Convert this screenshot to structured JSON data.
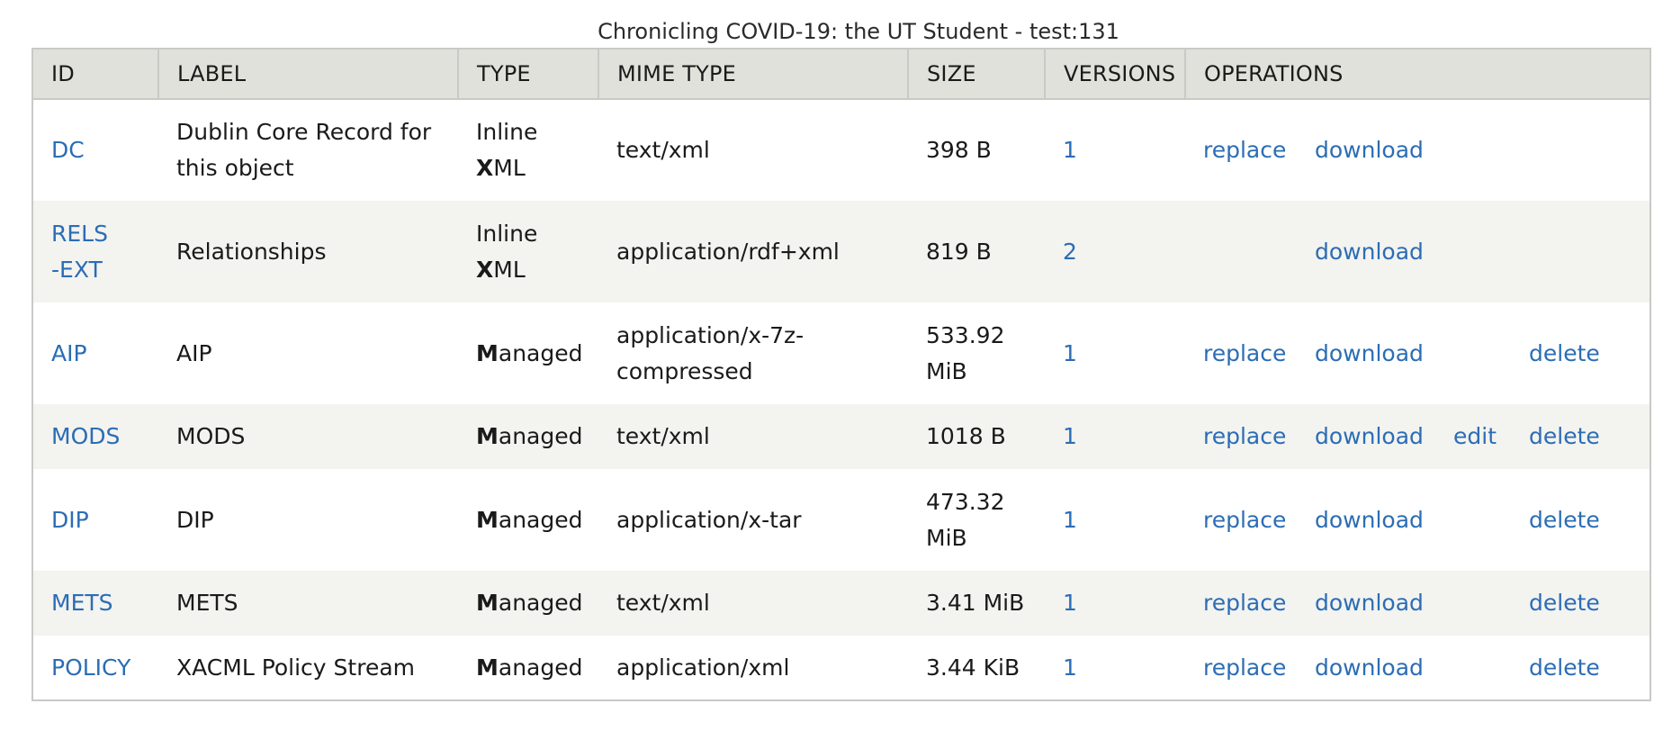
{
  "caption": "Chronicling COVID-19: the UT Student - test:131",
  "columns": [
    "ID",
    "LABEL",
    "TYPE",
    "MIME TYPE",
    "SIZE",
    "VERSIONS",
    "OPERATIONS"
  ],
  "rows": [
    {
      "id": "DC",
      "label": "Dublin Core Record for this object",
      "type_first": "Inline",
      "type_initial": "X",
      "type_rest": "ML",
      "mime": "text/xml",
      "size": "398 B",
      "versions": "1",
      "ops": {
        "replace": "replace",
        "download": "download",
        "edit": "",
        "delete": ""
      }
    },
    {
      "id": "RELS-EXT",
      "label": "Relationships",
      "type_first": "Inline",
      "type_initial": "X",
      "type_rest": "ML",
      "mime": "application/rdf+xml",
      "size": "819 B",
      "versions": "2",
      "ops": {
        "replace": "",
        "download": "download",
        "edit": "",
        "delete": ""
      }
    },
    {
      "id": "AIP",
      "label": "AIP",
      "type_first": "",
      "type_initial": "M",
      "type_rest": "anaged",
      "mime": "application/x-7z-compressed",
      "size": "533.92 MiB",
      "versions": "1",
      "ops": {
        "replace": "replace",
        "download": "download",
        "edit": "",
        "delete": "delete"
      }
    },
    {
      "id": "MODS",
      "label": "MODS",
      "type_first": "",
      "type_initial": "M",
      "type_rest": "anaged",
      "mime": "text/xml",
      "size": "1018 B",
      "versions": "1",
      "ops": {
        "replace": "replace",
        "download": "download",
        "edit": "edit",
        "delete": "delete"
      }
    },
    {
      "id": "DIP",
      "label": "DIP",
      "type_first": "",
      "type_initial": "M",
      "type_rest": "anaged",
      "mime": "application/x-tar",
      "size": "473.32 MiB",
      "versions": "1",
      "ops": {
        "replace": "replace",
        "download": "download",
        "edit": "",
        "delete": "delete"
      }
    },
    {
      "id": "METS",
      "label": "METS",
      "type_first": "",
      "type_initial": "M",
      "type_rest": "anaged",
      "mime": "text/xml",
      "size": "3.41 MiB",
      "versions": "1",
      "ops": {
        "replace": "replace",
        "download": "download",
        "edit": "",
        "delete": "delete"
      }
    },
    {
      "id": "POLICY",
      "label": "XACML Policy Stream",
      "type_first": "",
      "type_initial": "M",
      "type_rest": "anaged",
      "mime": "application/xml",
      "size": "3.44 KiB",
      "versions": "1",
      "ops": {
        "replace": "replace",
        "download": "download",
        "edit": "",
        "delete": "delete"
      }
    }
  ],
  "colors": {
    "link": "#2b6db5",
    "header_bg": "#e1e1dc",
    "stripe_bg": "#f3f3f0",
    "border": "#c9c9c7"
  }
}
